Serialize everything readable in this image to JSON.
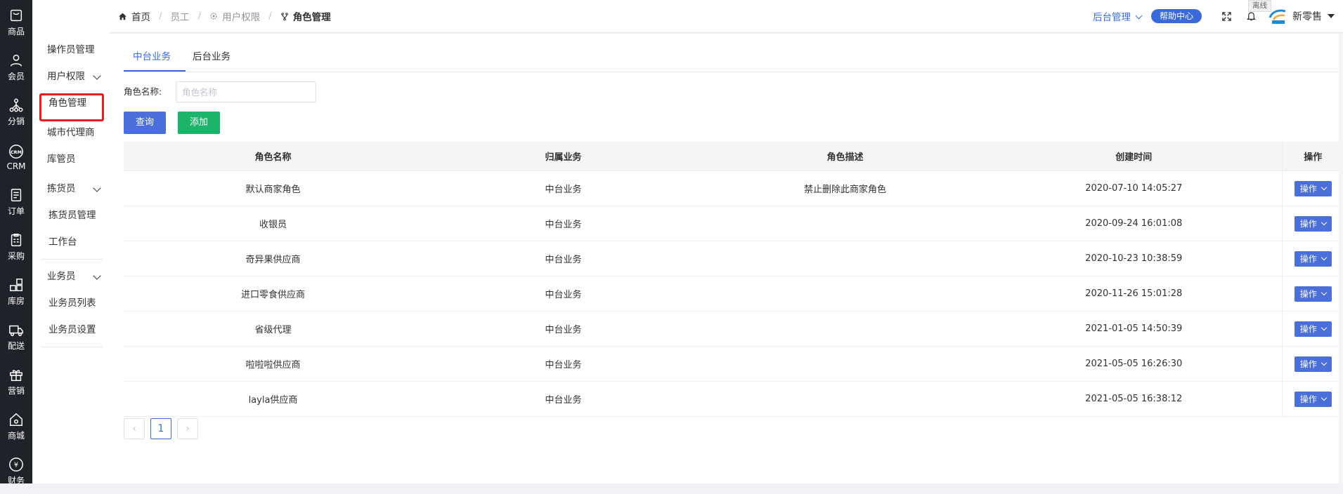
{
  "rail": [
    {
      "label": "商品",
      "icon": "shopping-bag-icon"
    },
    {
      "label": "会员",
      "icon": "user-icon"
    },
    {
      "label": "分销",
      "icon": "network-icon"
    },
    {
      "label": "CRM",
      "icon": "crm-icon"
    },
    {
      "label": "订单",
      "icon": "order-icon"
    },
    {
      "label": "采购",
      "icon": "purchase-icon"
    },
    {
      "label": "库房",
      "icon": "warehouse-icon"
    },
    {
      "label": "配送",
      "icon": "delivery-icon"
    },
    {
      "label": "营销",
      "icon": "gift-icon"
    },
    {
      "label": "商城",
      "icon": "home-icon"
    },
    {
      "label": "财务",
      "icon": "yen-icon"
    }
  ],
  "submenu": {
    "operator": "操作员管理",
    "permission": "用户权限",
    "role": "角色管理",
    "agent": "城市代理商",
    "keeper": "库管员",
    "picker": "拣货员",
    "picker_mgmt": "拣货员管理",
    "workbench": "工作台",
    "sales": "业务员",
    "sales_list": "业务员列表",
    "sales_settings": "业务员设置"
  },
  "breadcrumb": {
    "home": "首页",
    "staff": "员工",
    "permission": "用户权限",
    "current": "角色管理"
  },
  "header": {
    "backend": "后台管理",
    "help": "帮助中心",
    "status": "离线",
    "user": "新零售"
  },
  "tabs": [
    "中台业务",
    "后台业务"
  ],
  "search": {
    "label": "角色名称:",
    "placeholder": "角色名称"
  },
  "buttons": {
    "query": "查询",
    "add": "添加"
  },
  "table": {
    "headers": [
      "角色名称",
      "归属业务",
      "角色描述",
      "创建时间",
      "操作"
    ],
    "rows": [
      {
        "name": "默认商家角色",
        "biz": "中台业务",
        "desc": "禁止删除此商家角色",
        "time": "2020-07-10 14:05:27",
        "op": "操作"
      },
      {
        "name": "收银员",
        "biz": "中台业务",
        "desc": "",
        "time": "2020-09-24 16:01:08",
        "op": "操作"
      },
      {
        "name": "奇异果供应商",
        "biz": "中台业务",
        "desc": "",
        "time": "2020-10-23 10:38:59",
        "op": "操作"
      },
      {
        "name": "进口零食供应商",
        "biz": "中台业务",
        "desc": "",
        "time": "2020-11-26 15:01:28",
        "op": "操作"
      },
      {
        "name": "省级代理",
        "biz": "中台业务",
        "desc": "",
        "time": "2021-01-05 14:50:39",
        "op": "操作"
      },
      {
        "name": "啦啦啦供应商",
        "biz": "中台业务",
        "desc": "",
        "time": "2021-05-05 16:26:30",
        "op": "操作"
      },
      {
        "name": "layla供应商",
        "biz": "中台业务",
        "desc": "",
        "time": "2021-05-05 16:38:12",
        "op": "操作"
      }
    ]
  },
  "pagination": {
    "page": "1",
    "prev": "‹",
    "next": "›"
  }
}
